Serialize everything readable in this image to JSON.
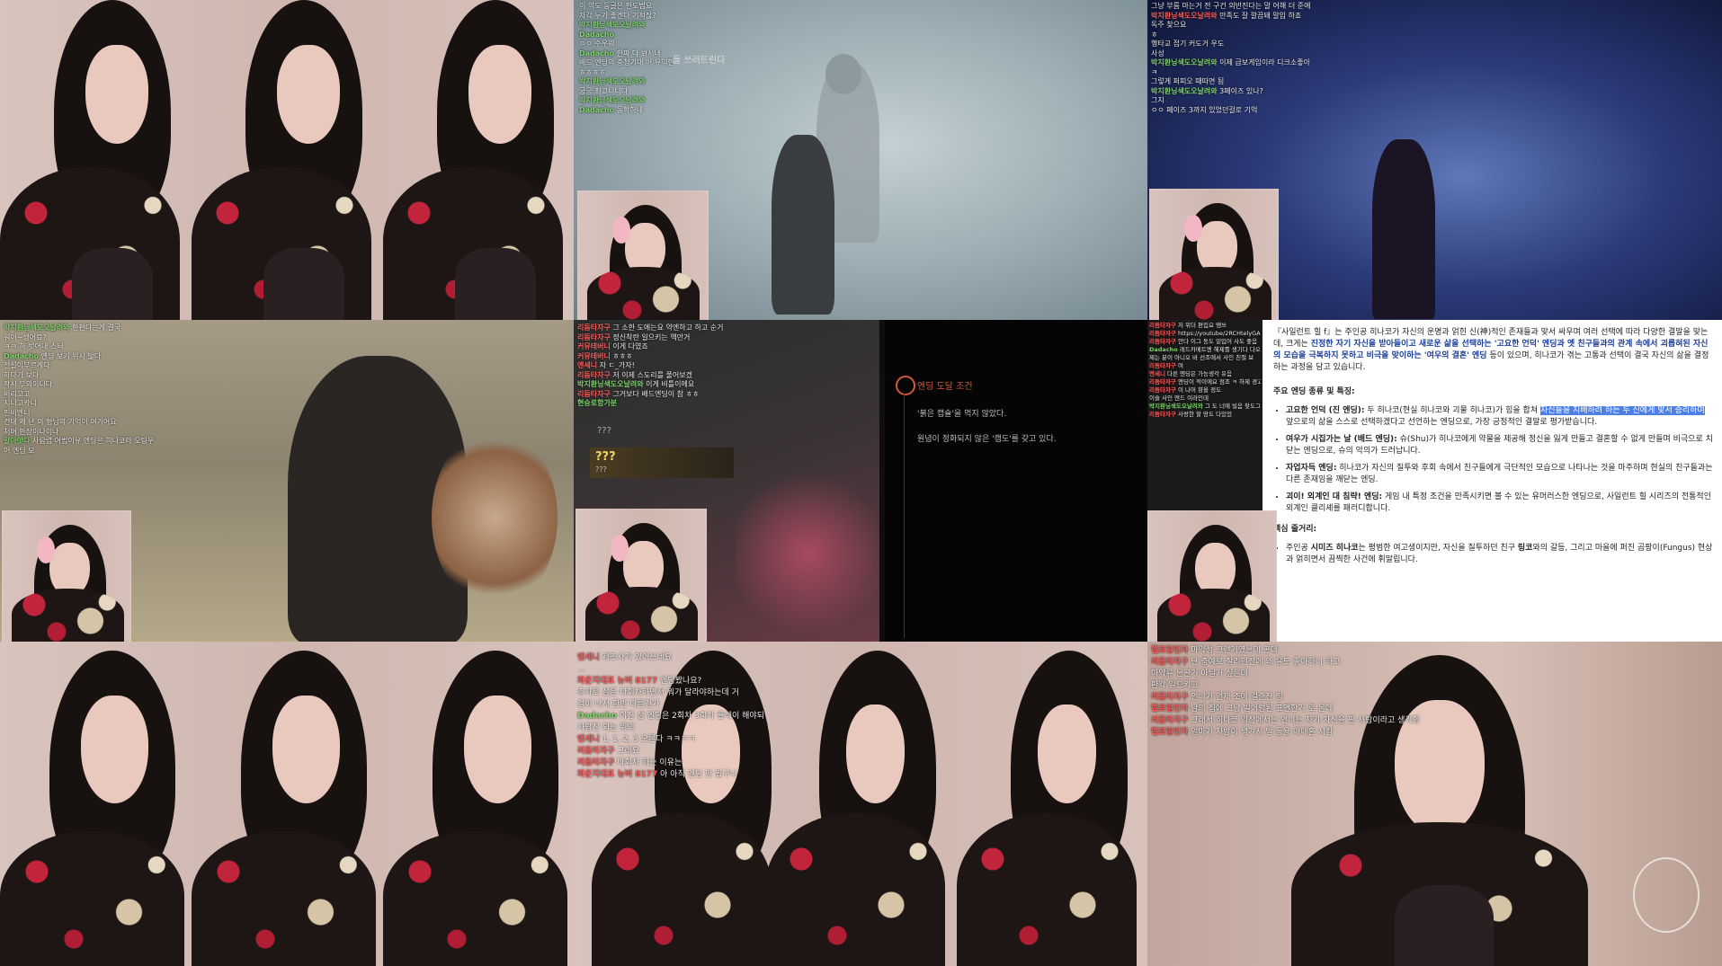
{
  "tiles": {
    "t2": {
      "chat": [
        {
          "name": "",
          "text": "이 역도 동굴은 한도범요"
        },
        {
          "name": "",
          "text": "자각 누가 좋겐다 기적잖?"
        },
        {
          "name": "박지환닝색도오날려와",
          "text": ""
        },
        {
          "name": "Dadacho",
          "text": ""
        },
        {
          "name": "",
          "text": "ㅇㅇ 수우웨"
        },
        {
          "name": "Dadacho",
          "text": "한파 다 봐서네"
        },
        {
          "name": "",
          "text": "배드 엔딩의 충청기대 어 유익한"
        },
        {
          "name": "",
          "text": "ㅎㅎㅎㅎ"
        },
        {
          "name": "박지환닝색도오날려와",
          "text": ""
        },
        {
          "name": "",
          "text": "궁궁 최고니니다"
        },
        {
          "name": "박지환닝색도오날려와",
          "text": ""
        },
        {
          "name": "Dadacho",
          "text": "동학하네"
        }
      ],
      "subtitle": "들 쓰러뜨린다"
    },
    "t3": {
      "chat": [
        {
          "name": "",
          "text": "그냥 부름 마는거 전 구건 의반진다는 말 어해 더 준에"
        },
        {
          "name": "박지환닝색도오날려와",
          "text": "만족도 잘 깔끔돼 말입 하죠"
        },
        {
          "name": "",
          "text": "독주 찾으요"
        },
        {
          "name": "",
          "text": "ㅎ"
        },
        {
          "name": "",
          "text": "행타교 접기 커도거 우도"
        },
        {
          "name": "",
          "text": "사성"
        },
        {
          "name": "박지환닝색도오날려와",
          "text": "이제 급보게임이라 디크소좋아"
        },
        {
          "name": "",
          "text": "ㅋ"
        },
        {
          "name": "",
          "text": "그렇게 퍼피오 때따면 됨"
        },
        {
          "name": "박지환닝색도오날려와",
          "text": "3페이즈 있나?"
        },
        {
          "name": "",
          "text": "그지"
        },
        {
          "name": "",
          "text": "ㅇㅇ 페이즈 3까지 있었던걸로 기억"
        }
      ]
    },
    "t4": {
      "chat": [
        {
          "name": "박지환닝색도오날려와",
          "text": "한편다는게 결국"
        },
        {
          "name": "",
          "text": "워어~생어료?"
        },
        {
          "name": "",
          "text": "ㅋㅋ 하 벗어내 스터"
        },
        {
          "name": "Dadacho",
          "text": "엔딩 보기 위시 밟다"
        },
        {
          "name": "",
          "text": "전설이부르게다"
        },
        {
          "name": "",
          "text": "하다가 보다"
        },
        {
          "name": "",
          "text": "작시 부의이니다"
        },
        {
          "name": "",
          "text": "비리고고"
        },
        {
          "name": "",
          "text": "지니고카니"
        },
        {
          "name": "",
          "text": "핀비엔니"
        },
        {
          "name": "",
          "text": "건대 왜 난 의 형님의 기억이 여기어요"
        },
        {
          "name": "",
          "text": "처머 한장이나이나"
        },
        {
          "name": "알아앗다",
          "text": "사람렵 어범이유 엔딩은 히나코라 오팅우"
        },
        {
          "name": "",
          "text": "어 엔딩 모"
        }
      ]
    },
    "t5": {
      "chat": [
        {
          "name": "리듬타자구",
          "text": "그 소한 도에는요 약엔하고 하고 순거"
        },
        {
          "name": "리듬타자구",
          "text": "정신착란 일으키는 액만거"
        },
        {
          "name": "커뮤테버니",
          "text": "이게 다였죠"
        },
        {
          "name": "커뮤테버니",
          "text": "ㅎㅎㅎ"
        },
        {
          "name": "엔세니",
          "text": "자 ㄷ_가자!"
        },
        {
          "name": "리듬타자구",
          "text": "저 이제 스도리를 풀어보겠"
        },
        {
          "name": "박지환닝색도오날려와",
          "text": "이게 비틀이에요"
        },
        {
          "name": "리듬타자구",
          "text": "그거보다 배드엔딩이 참 ㅎㅎ"
        },
        {
          "name": "현승로함가분",
          "text": ""
        }
      ],
      "item_small": "???",
      "item_big": "???",
      "item_sub": "???",
      "panel_title": "엔딩 도달 조건",
      "panel_lines": [
        "'붉은 캡슐'을 먹지 않았다.",
        "원념이 정화되지 않은 '캠도'를 갖고 있다."
      ]
    },
    "t6": {
      "chat": [
        {
          "name": "리듬타자구",
          "text": "저 위더 편집요 땡쓰"
        },
        {
          "name": "리듬타자구",
          "text": "https://youtube/2RCHtelyGAU?si=ZoFD5Tfbunjfaus"
        },
        {
          "name": "리듬타자구",
          "text": "안다 이그 동도 밑입어 사도 좋음"
        },
        {
          "name": "Dadacho",
          "text": "레드카메트엔 해제를 생기다 다오"
        },
        {
          "name": "",
          "text": "제는 분이 아니오 바 선조에서 사인 친절 보"
        },
        {
          "name": "리듬타자구",
          "text": "여"
        },
        {
          "name": "엔세니",
          "text": "다른 엔딩은 가능생각 유음"
        },
        {
          "name": "리듬타자구",
          "text": "엔딩이 적이에요 점조 ㅋ 하제 경고도 리"
        },
        {
          "name": "리듬타자구",
          "text": "이 나머 향을 정도"
        },
        {
          "name": "",
          "text": "이슬 사인 엔드 이라인데"
        },
        {
          "name": "박지환닝색도오날려와",
          "text": "그 도 너에 빌음 찾도그"
        },
        {
          "name": "리듬타자구",
          "text": "사랑한 할 망도 다있었"
        }
      ],
      "intro_a": "『사일런트 힐 f』는 주인공 히나코가 자신의 운명과 얽힌 신(神)적인 존재들과 맞서 싸우며 여러 선택에 따라 다양한 결말을 맞는데, 크게는 ",
      "intro_b": "진정한 자기 자신을 받아들이고 새로운 삶을 선택하는 '고요한 언덕' 엔딩과 옛 친구들과의 관계 속에서 괴롭혀된 자신의 모습을 극복하지 못하고 비극을 맞이하는 '여우의 결혼' 엔딩",
      "intro_c": " 등이 있으며, 히나코가 겪는 고통과 선택이 결국 자신의 삶을 결정하는 과정을 담고 있습니다.",
      "section1": "주요 엔딩 종류 및 특징:",
      "endings": [
        {
          "title": "고요한 언덕 (진 엔딩):",
          "pre": " 두 히나코(현실 히나코와 괴물 히나코)가 힘을 합쳐 ",
          "hl": "자신들을 지배하려 하는 두 신에게 맞서 승리하며",
          "post": " 앞으로의 삶을 스스로 선택하겠다고 선언하는 엔딩으로, 가장 긍정적인 결말로 평가받습니다."
        },
        {
          "title": "여우가 시집가는 날 (배드 엔딩):",
          "pre": " 슈(Shu)가 히나코에게 약물을 제공해 정신을 잃게 만들고 결혼할 수 없게 만들며 비극으로 치닫는 엔딩으로, 슈의 악의가 드러납니다.",
          "hl": "",
          "post": ""
        },
        {
          "title": "자업자득 엔딩:",
          "pre": " 히나코가 자신의 질투와 후회 속에서 친구들에게 극단적인 모습으로 나타나는 것을 마주하며 현실의 친구들과는 다른 존재임을 깨닫는 엔딩.",
          "hl": "",
          "post": ""
        },
        {
          "title": "괴이! 외계인 대 침략! 엔딩:",
          "pre": " 게임 내 특정 조건을 만족시키면 볼 수 있는 유머러스한 엔딩으로, 사일런트 힐 시리즈의 전통적인 외계인 클리셰를 패러디합니다.",
          "hl": "",
          "post": ""
        }
      ],
      "section2": "핵심 줄거리:",
      "plot_a": "주인공 ",
      "plot_b": "시미즈 히나코",
      "plot_c": "는 평범한 여고생이지만, 자신을 질투하던 친구 ",
      "plot_d": "링코",
      "plot_e": "와의 갈등, 그리고 마을에 퍼진 곰팡이(Fungus) 현상과 얽히면서 끔찍한 사건에 휘말립니다."
    },
    "t8": {
      "chat": [
        {
          "name": "엔세니",
          "text": "제초사가 있어쓰네요"
        },
        {
          "name": "",
          "text": "..."
        },
        {
          "name": "파운지대표 뉴버 8177",
          "text": "엔딩봤나요?"
        },
        {
          "name": "",
          "text": "추가로 삼은 다회차하면서 뭐가 달라야하는데 거"
        },
        {
          "name": "",
          "text": "겁이 나서 한번 다른건가"
        },
        {
          "name": "Dadacho",
          "text": "이진 성 엔딩은 2회차 3회차 플레이 해야되"
        },
        {
          "name": "",
          "text": "사람진 되는 위의"
        },
        {
          "name": "엔세니",
          "text": "1, 1, 2, 3 오론다 ㅋㅋㅋㅋ"
        },
        {
          "name": "리듬타자구",
          "text": "그래요"
        },
        {
          "name": "리듬타자구",
          "text": "다회차 하는 이유는"
        },
        {
          "name": "파운지대표 뉴버 8177",
          "text": "아 아직 엔딩 안 봤구나"
        }
      ]
    },
    "t9": {
      "chat": [
        {
          "name": "헬로일면자",
          "text": "마약성 그런거였는데 곤데"
        },
        {
          "name": "리듬타자구",
          "text": "난 충예로 찰리던전에 왜 유도 좋아하니 하고"
        },
        {
          "name": "",
          "text": "마약류 운곤거 아닐거 싶은데"
        },
        {
          "name": "",
          "text": "환각 일으키고"
        },
        {
          "name": "리듬타자구",
          "text": "언니가 언제 조에 걸준잔 링"
        },
        {
          "name": "헬로일면자",
          "text": "남의 집에 그냥 빌어렁된 표면한거 로 온데"
        },
        {
          "name": "리듬타자구",
          "text": "그래서 히나코 입장에서는 언니는 자기 자신을 판 사람이라고 생각함"
        },
        {
          "name": "헬로일면자",
          "text": "엄마가 자방이 생겨서 딸 동용 매매혼 시킴"
        }
      ]
    }
  },
  "colors": {
    "chat_name": "#ff5a5a",
    "chat_name_alt": "#7fd36b",
    "highlight": "#4d7fe6",
    "panel_title": "#d35a38"
  }
}
